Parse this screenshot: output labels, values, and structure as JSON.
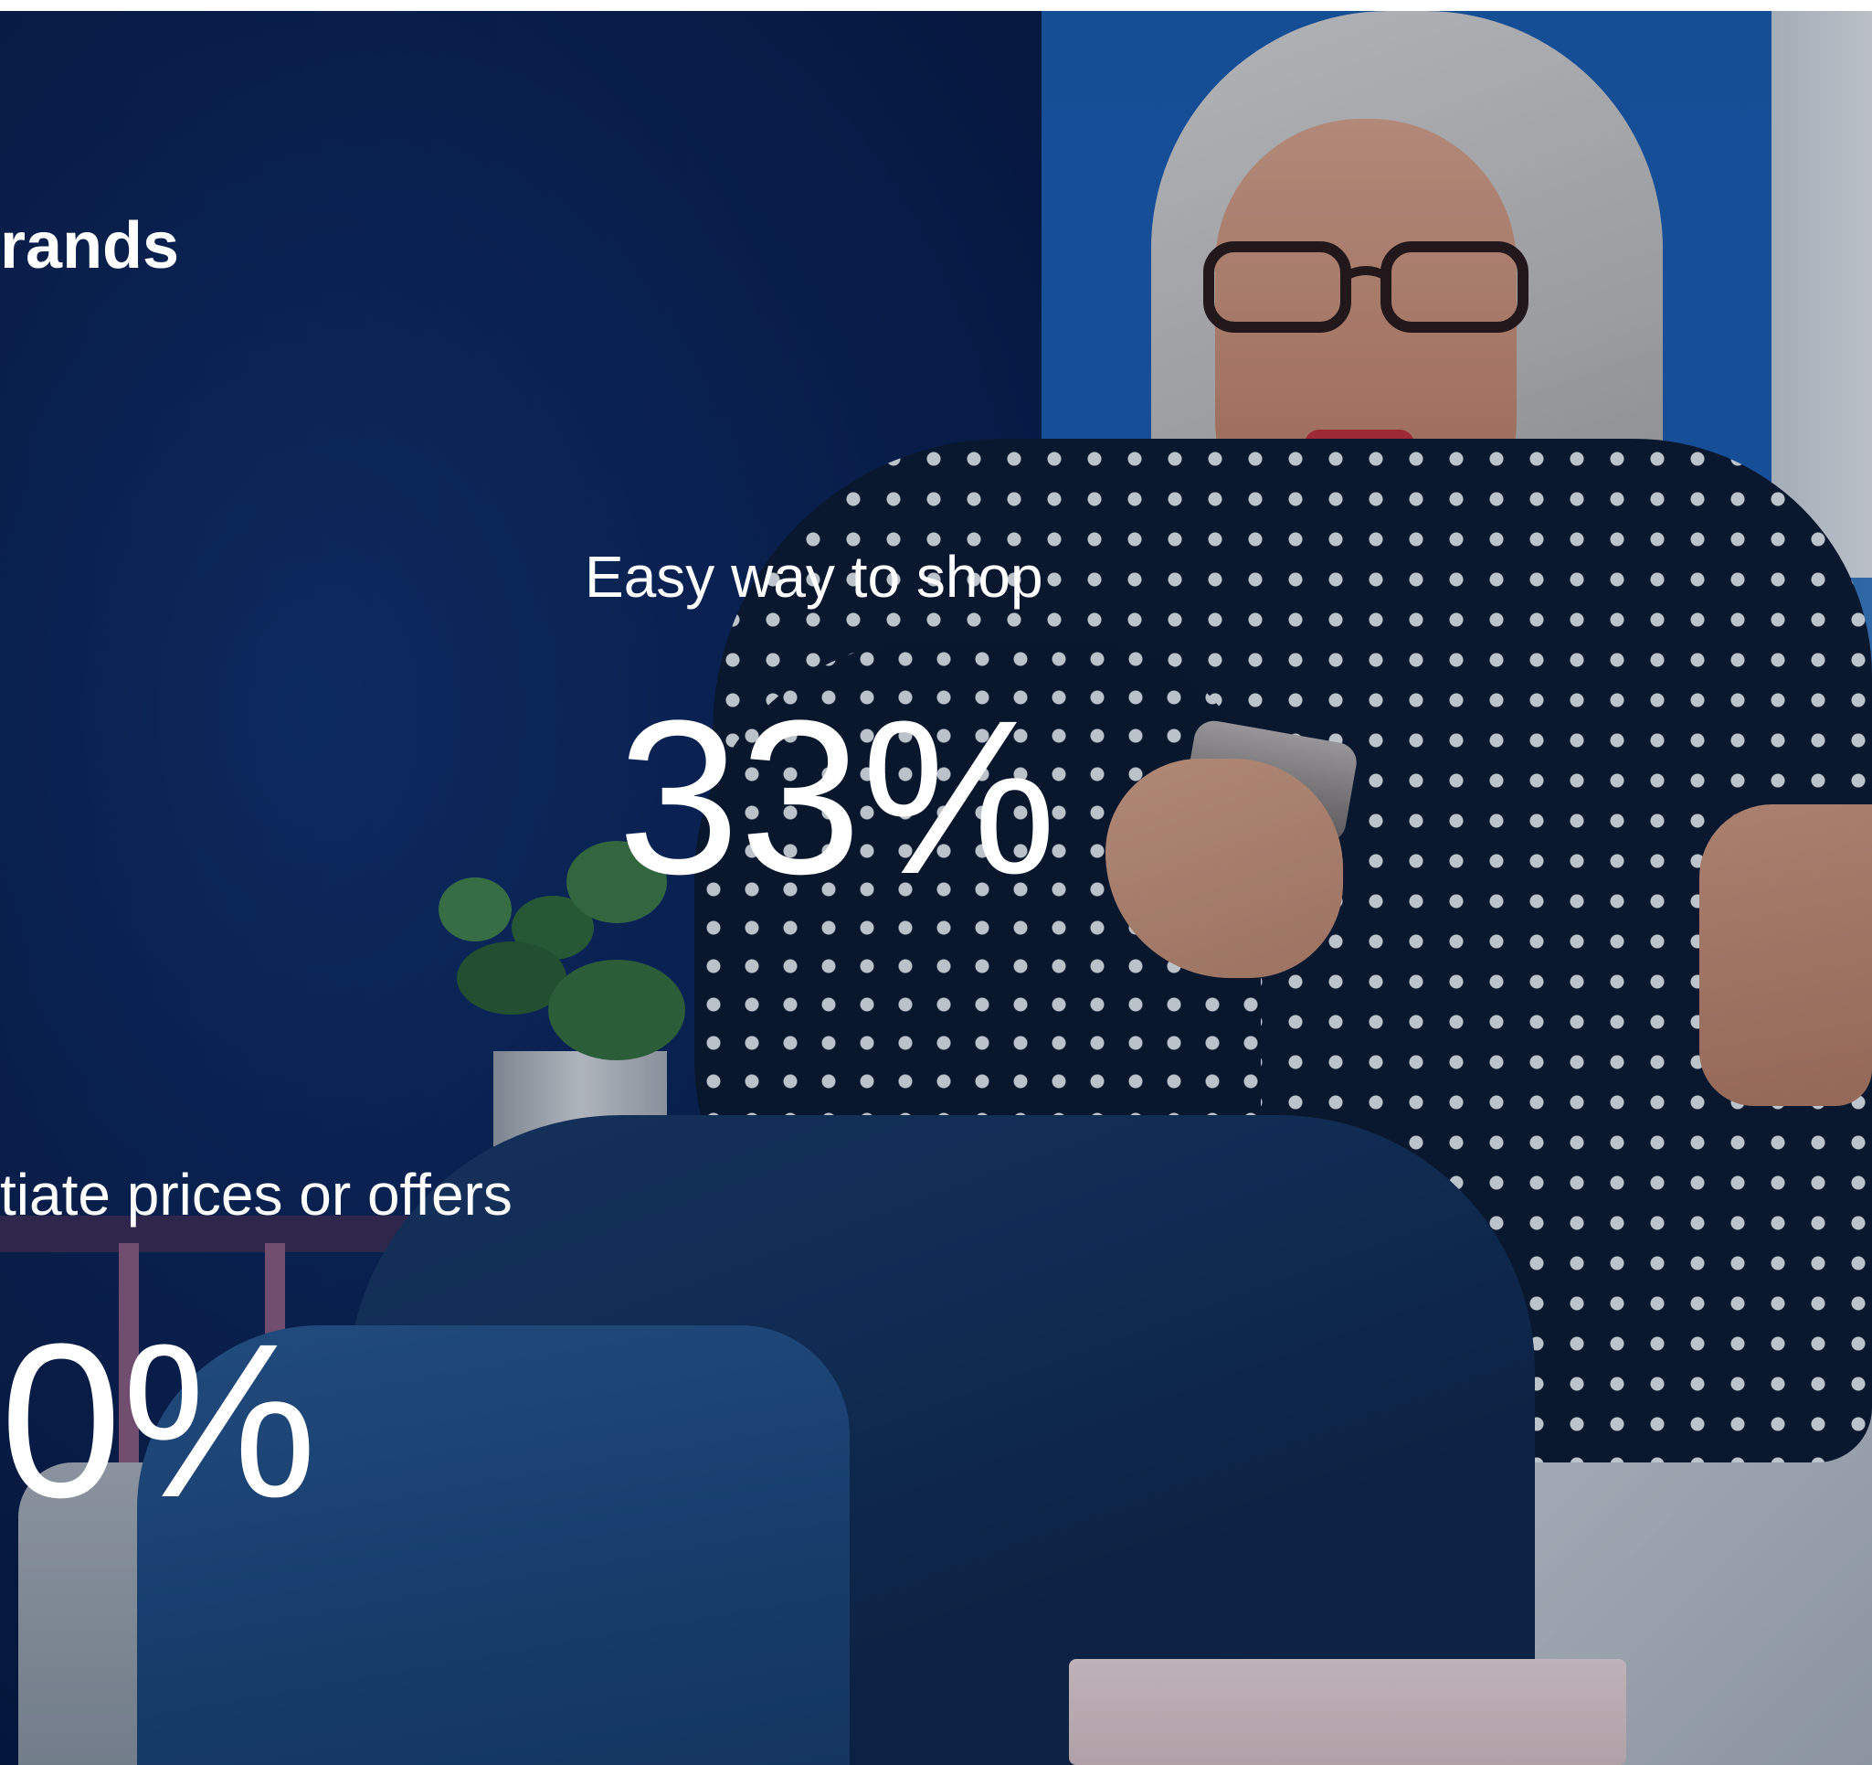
{
  "heading": "rands",
  "stats": [
    {
      "label": "Easy way to shop",
      "value": "33%"
    },
    {
      "label": "tiate prices or offers",
      "value": "0%"
    }
  ],
  "colors": {
    "background_dark_blue": "#0a2454",
    "wall_blue": "#1b5db0",
    "text": "#ffffff"
  }
}
